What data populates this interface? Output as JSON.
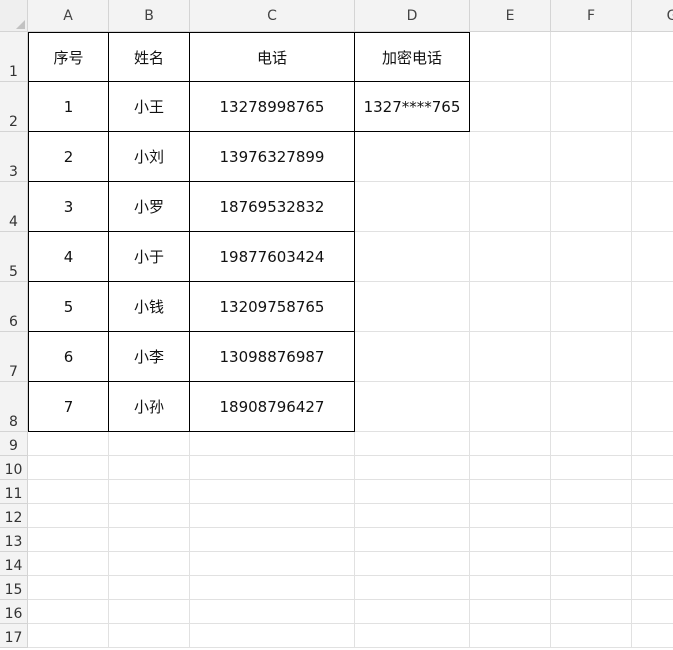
{
  "columns": [
    "A",
    "B",
    "C",
    "D",
    "E",
    "F",
    "G"
  ],
  "rows": [
    "1",
    "2",
    "3",
    "4",
    "5",
    "6",
    "7",
    "8",
    "9",
    "10",
    "11",
    "12",
    "13",
    "14",
    "15",
    "16",
    "17"
  ],
  "table": {
    "headers": [
      "序号",
      "姓名",
      "电话",
      "加密电话"
    ],
    "rows": [
      [
        "1",
        "小王",
        "13278998765",
        "1327****765"
      ],
      [
        "2",
        "小刘",
        "13976327899",
        ""
      ],
      [
        "3",
        "小罗",
        "18769532832",
        ""
      ],
      [
        "4",
        "小于",
        "19877603424",
        ""
      ],
      [
        "5",
        "小钱",
        "13209758765",
        ""
      ],
      [
        "6",
        "小李",
        "13098876987",
        ""
      ],
      [
        "7",
        "小孙",
        "18908796427",
        ""
      ]
    ]
  }
}
